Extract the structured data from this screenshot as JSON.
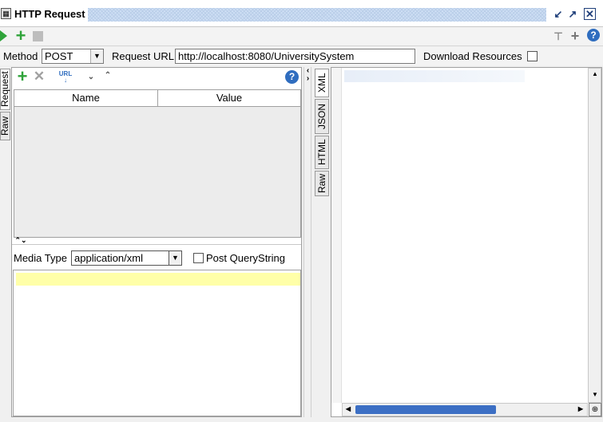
{
  "window": {
    "title": "HTTP Request"
  },
  "urlbar": {
    "method_label": "Method",
    "method_value": "POST",
    "url_label": "Request URL:",
    "url_value": "http://localhost:8080/UniversitySystem",
    "download_label": "Download Resources"
  },
  "left_tabs": [
    "Request",
    "Raw"
  ],
  "table": {
    "columns": [
      "Name",
      "Value"
    ]
  },
  "media": {
    "label": "Media Type",
    "value": "application/xml",
    "post_query_label": "Post QueryString"
  },
  "right_tabs": [
    "XML",
    "JSON",
    "HTML",
    "Raw"
  ],
  "colors": {
    "accent_green": "#2fa33a",
    "title_hatch": "#cfe0f5",
    "highlight": "#ffffa8"
  }
}
